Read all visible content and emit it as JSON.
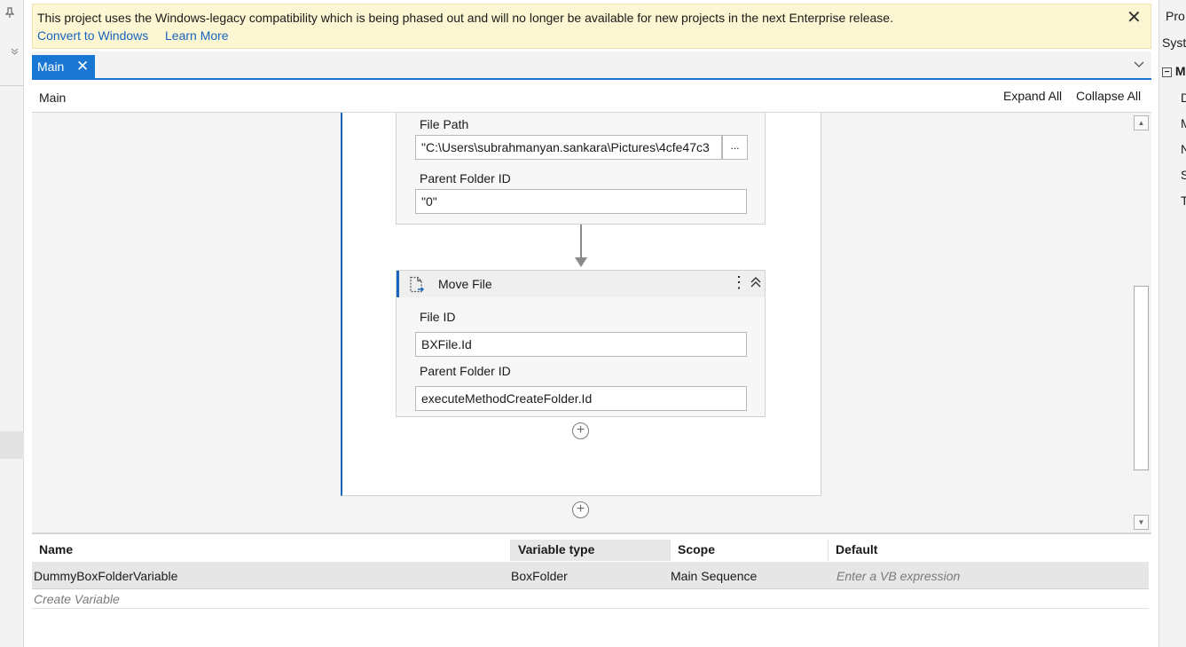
{
  "banner": {
    "message": "This project uses the Windows-legacy compatibility which is being phased out and will no longer be available for new projects in the next Enterprise release.",
    "link_convert": "Convert to Windows",
    "link_learn": "Learn More",
    "close": "✕"
  },
  "tabs": {
    "main_label": "Main",
    "close": "✕",
    "dropdown": "⌄"
  },
  "breadcrumb": {
    "label": "Main",
    "expand_all": "Expand All",
    "collapse_all": "Collapse All"
  },
  "activity_upload": {
    "file_path_label": "File Path",
    "file_path_value": "\"C:\\Users\\subrahmanyan.sankara\\Pictures\\4cfe47c3",
    "browse": "...",
    "parent_folder_label": "Parent Folder ID",
    "parent_folder_value": "\"0\""
  },
  "activity_move": {
    "title": "Move File",
    "icon": "file-move-icon",
    "kebab": "⋮",
    "file_id_label": "File ID",
    "file_id_value": "BXFile.Id",
    "parent_folder_label": "Parent Folder ID",
    "parent_folder_value": "executeMethodCreateFolder.Id"
  },
  "add_activity": "+",
  "variables": {
    "headers": [
      "Name",
      "Variable type",
      "Scope",
      "Default"
    ],
    "rows": [
      {
        "name": "DummyBoxFolderVariable",
        "type": "BoxFolder",
        "scope": "Main Sequence",
        "default_placeholder": "Enter a VB expression"
      }
    ],
    "create": "Create Variable"
  },
  "right_panel": {
    "items": [
      "Pro",
      "Syst",
      "M",
      "D",
      "M",
      "N",
      "S",
      "T"
    ]
  },
  "colors": {
    "accent": "#1976d2",
    "banner_bg": "#fdf6d2",
    "link": "#1565c0"
  }
}
